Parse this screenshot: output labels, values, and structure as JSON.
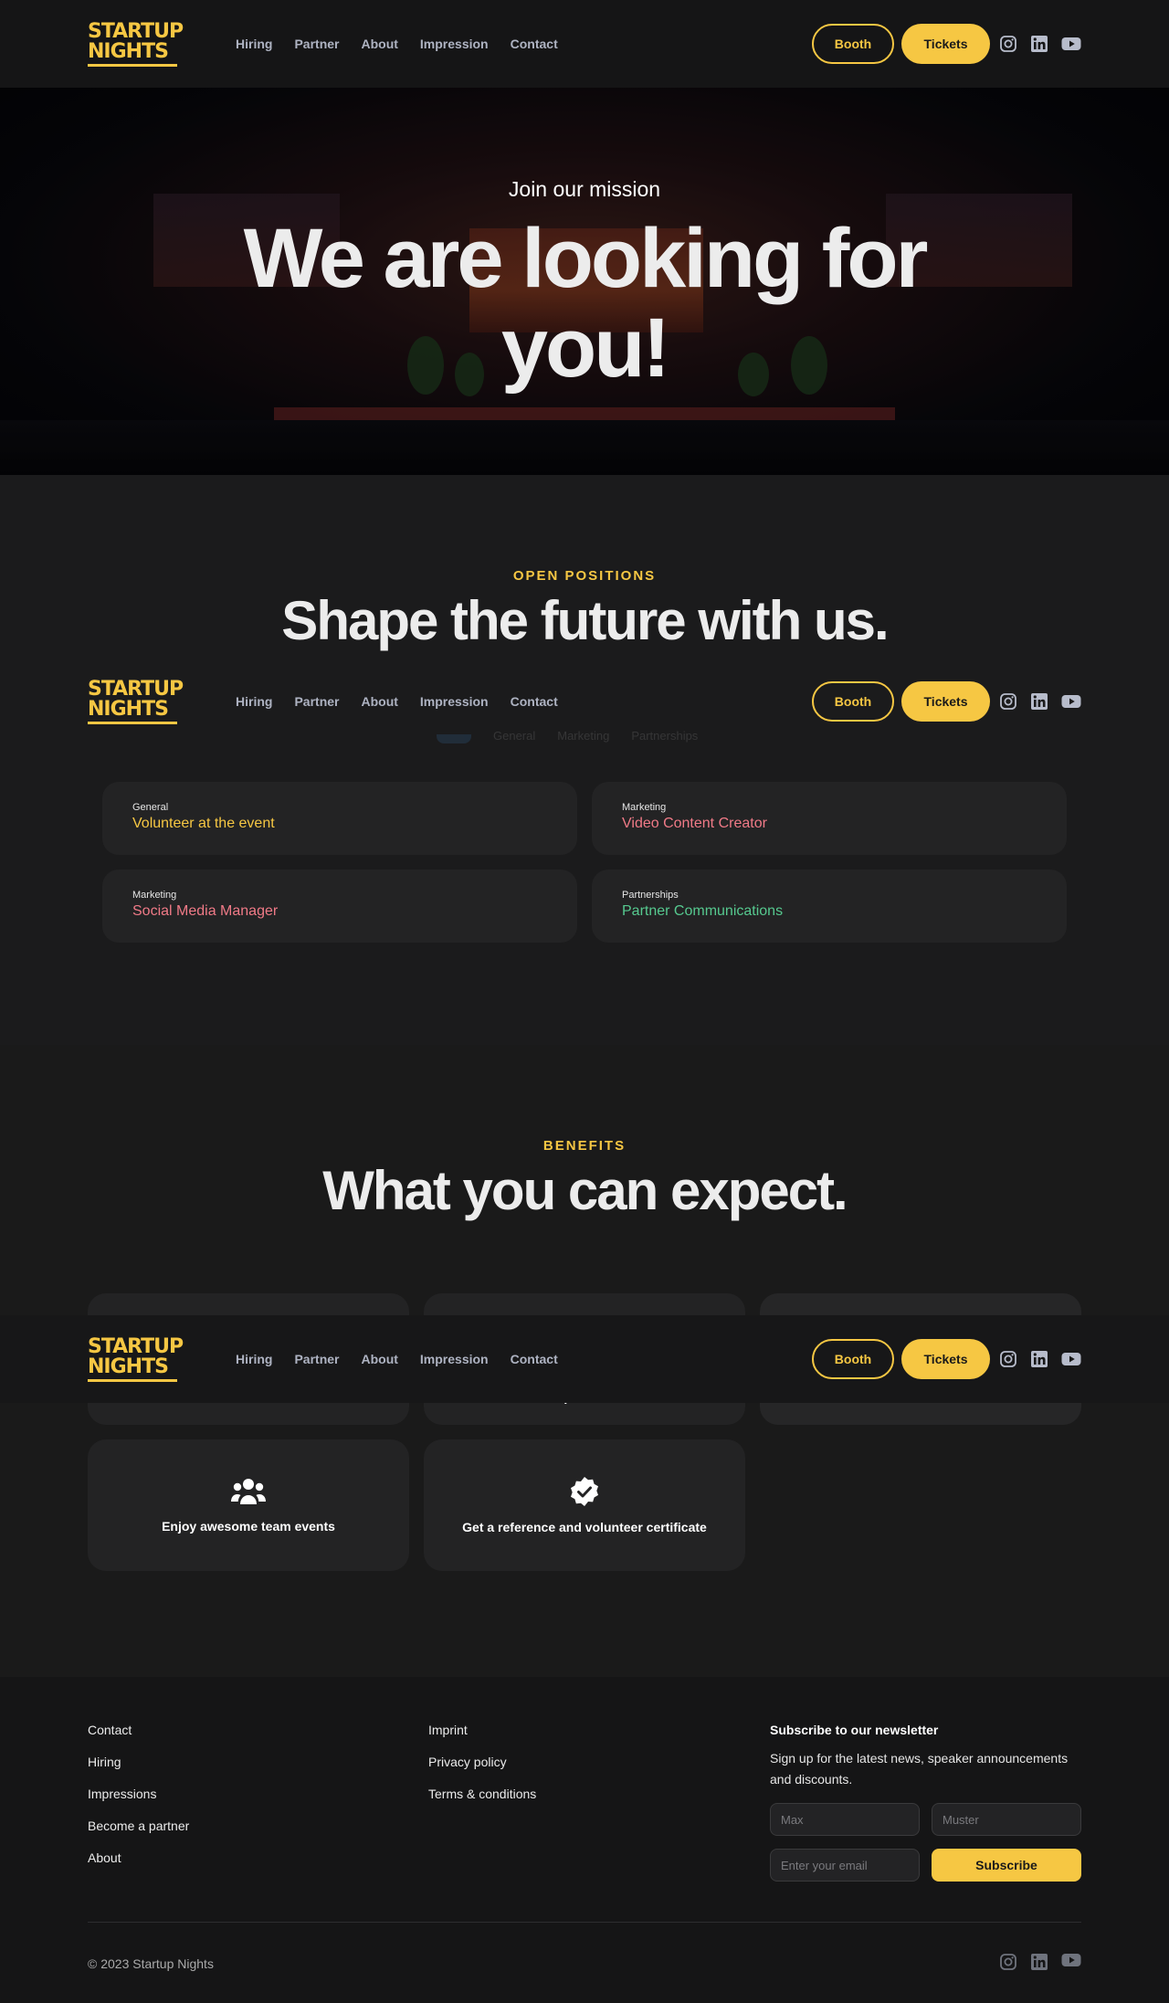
{
  "brand": {
    "logo_line1": "STARTUP",
    "logo_line2": "NIGHTS",
    "color": "#f6c743"
  },
  "nav": {
    "links": [
      "Hiring",
      "Partner",
      "About",
      "Impression",
      "Contact"
    ],
    "booth_label": "Booth",
    "tickets_label": "Tickets",
    "social_icons": [
      "instagram-icon",
      "linkedin-icon",
      "youtube-icon"
    ]
  },
  "hero": {
    "kicker": "Join our mission",
    "title": "We are looking for you!"
  },
  "positions": {
    "kicker": "OPEN POSITIONS",
    "title": "Shape the future with us.",
    "filters": [
      "General",
      "Marketing",
      "Partnerships"
    ],
    "jobs": [
      {
        "category": "General",
        "title": "Volunteer at the event",
        "color": "#f6c743"
      },
      {
        "category": "Marketing",
        "title": "Video Content Creator",
        "color": "#f07a87"
      },
      {
        "category": "Marketing",
        "title": "Social Media Manager",
        "color": "#f07a87"
      },
      {
        "category": "Partnerships",
        "title": "Partner Communications",
        "color": "#56c98f"
      }
    ]
  },
  "benefits": {
    "kicker": "BENEFITS",
    "title": "What you can expect.",
    "cards": [
      {
        "text": "",
        "icon": ""
      },
      {
        "text": "speakers",
        "icon": ""
      },
      {
        "text": "",
        "icon": ""
      },
      {
        "text": "Enjoy awesome team events",
        "icon": "team-icon"
      },
      {
        "text": "Get a reference and volunteer certificate",
        "icon": "certificate-badge-icon"
      }
    ]
  },
  "footer": {
    "col1": [
      "Contact",
      "Hiring",
      "Impressions",
      "Become a partner",
      "About"
    ],
    "col2": [
      "Imprint",
      "Privacy policy",
      "Terms & conditions"
    ],
    "newsletter": {
      "title": "Subscribe to our newsletter",
      "desc": "Sign up for the latest news, speaker announcements and discounts.",
      "first_placeholder": "Max",
      "last_placeholder": "Muster",
      "email_placeholder": "Enter your email",
      "subscribe_label": "Subscribe"
    },
    "copyright": "© 2023 Startup Nights"
  }
}
